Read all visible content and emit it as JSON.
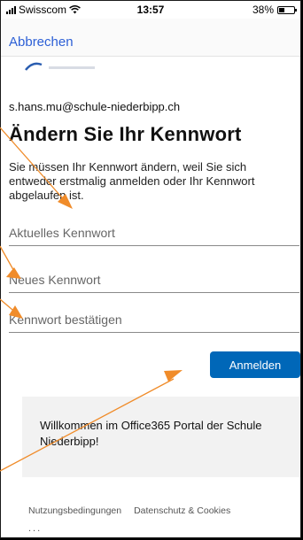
{
  "statusbar": {
    "carrier": "Swisscom",
    "time": "13:57",
    "battery": "38%",
    "battery_level": 0.38
  },
  "nav": {
    "cancel_label": "Abbrechen"
  },
  "account": {
    "email": "s.hans.mu@schule-niederbipp.ch"
  },
  "page": {
    "title": "Ändern Sie Ihr Kennwort",
    "description": "Sie müssen Ihr Kennwort ändern, weil Sie sich entweder erstmalig anmelden oder Ihr Kennwort abgelaufen ist."
  },
  "form": {
    "current_password_placeholder": "Aktuelles Kennwort",
    "new_password_placeholder": "Neues Kennwort",
    "confirm_password_placeholder": "Kennwort bestätigen",
    "submit_label": "Anmelden"
  },
  "banner": {
    "text": "Willkommen im Office365 Portal der Schule Niederbipp!"
  },
  "footer": {
    "terms_label": "Nutzungsbedingungen",
    "privacy_label": "Datenschutz & Cookies",
    "more_label": "..."
  },
  "colors": {
    "accent": "#2c5fd6",
    "button": "#0067b8",
    "annotation_arrow": "#f08c2a"
  }
}
